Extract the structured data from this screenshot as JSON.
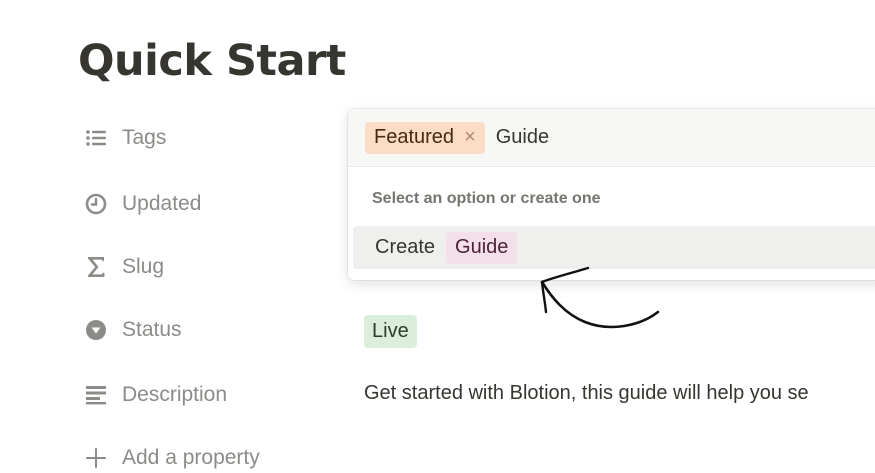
{
  "page": {
    "title": "Quick Start"
  },
  "properties": [
    {
      "icon": "list-icon",
      "label": "Tags"
    },
    {
      "icon": "clock-icon",
      "label": "Updated"
    },
    {
      "icon": "sigma-icon",
      "label": "Slug"
    },
    {
      "icon": "status-icon",
      "label": "Status"
    },
    {
      "icon": "text-lines-icon",
      "label": "Description"
    },
    {
      "icon": "plus-icon",
      "label": "Add a property"
    }
  ],
  "values": {
    "status": "Live",
    "description": "Get started with Blotion, this guide will help you se"
  },
  "dropdown": {
    "selected_tag": "Featured",
    "remove_symbol": "×",
    "typed_text": "Guide",
    "hint": "Select an option or create one",
    "create_label": "Create",
    "create_option": "Guide"
  },
  "colors": {
    "featured_tag": "#fbdcc7",
    "guide_tag": "#f5e0e9",
    "live_tag": "#dbeddb",
    "label_gray": "#8c8b87"
  }
}
